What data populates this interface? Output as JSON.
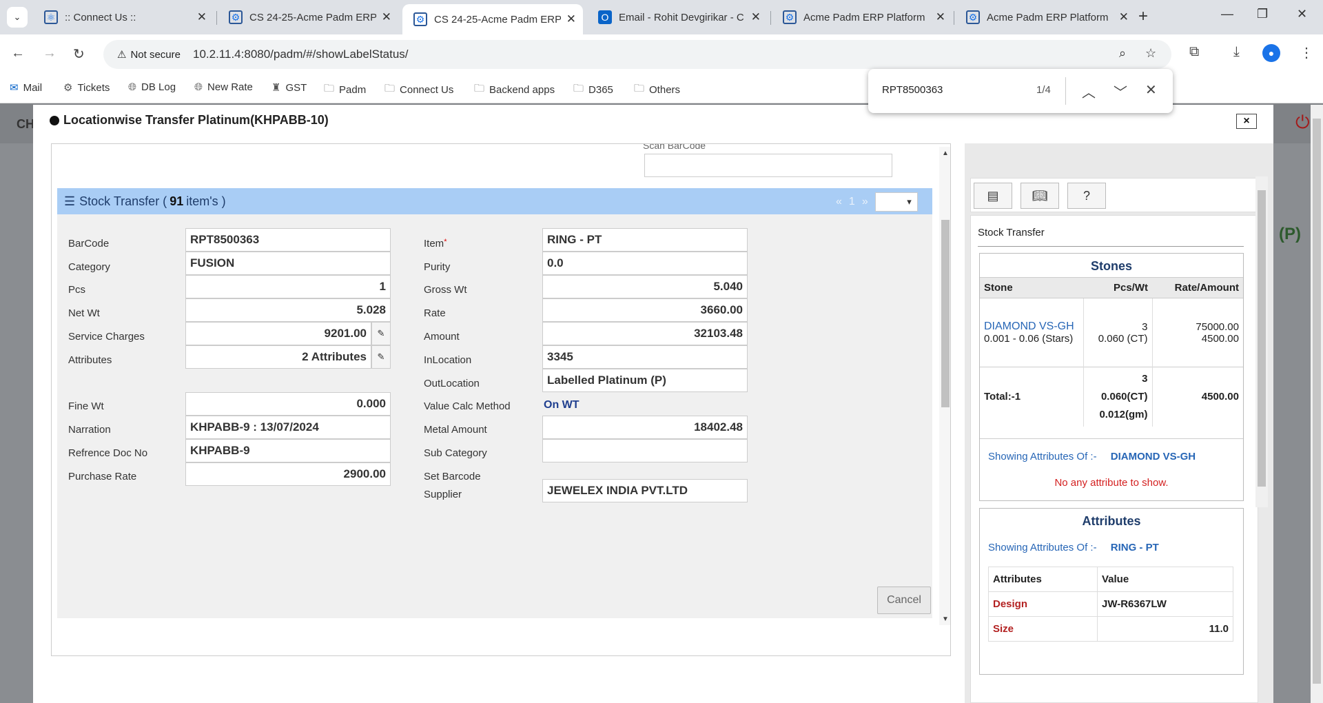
{
  "browser": {
    "tabs": [
      {
        "title": ":: Connect Us ::",
        "active": false
      },
      {
        "title": "CS 24-25-Acme Padm ERP",
        "active": false
      },
      {
        "title": "CS 24-25-Acme Padm ERP",
        "active": true
      },
      {
        "title": "Email - Rohit Devgirikar - C",
        "active": false
      },
      {
        "title": "Acme Padm ERP Platform",
        "active": false
      },
      {
        "title": "Acme Padm ERP Platform",
        "active": false
      }
    ],
    "security_label": "Not secure",
    "url": "10.2.11.4:8080/padm/#/showLabelStatus/",
    "bookmarks": [
      "Mail",
      "Tickets",
      "DB Log",
      "New Rate",
      "GST",
      "Padm",
      "Connect Us",
      "Backend apps",
      "D365",
      "Others"
    ]
  },
  "findbar": {
    "query": "RPT8500363",
    "count": "1/4"
  },
  "background": {
    "left_text": "CH",
    "right_label": "(P)"
  },
  "modal": {
    "title": "Locationwise Transfer Platinum(KHPABB-10)",
    "close": "×",
    "scan_label": "Scan BarCode",
    "stock": {
      "label_pre": "Stock Transfer (",
      "count": "91",
      "label_post": "item's )",
      "pager_prev": "«",
      "pager_page": "1",
      "pager_next": "»"
    },
    "left_fields": {
      "barcode": {
        "label": "BarCode",
        "value": "RPT8500363"
      },
      "category": {
        "label": "Category",
        "value": "FUSION"
      },
      "pcs": {
        "label": "Pcs",
        "value": "1"
      },
      "net_wt": {
        "label": "Net Wt",
        "value": "5.028"
      },
      "service_charges": {
        "label": "Service Charges",
        "value": "9201.00"
      },
      "attributes": {
        "label": "Attributes",
        "value": "2 Attributes"
      },
      "fine_wt": {
        "label": "Fine Wt",
        "value": "0.000"
      },
      "narration": {
        "label": "Narration",
        "value": "KHPABB-9 : 13/07/2024"
      },
      "ref_doc": {
        "label": "Refrence Doc No",
        "value": "KHPABB-9"
      },
      "purchase_rate": {
        "label": "Purchase Rate",
        "value": "2900.00"
      }
    },
    "right_fields": {
      "item": {
        "label": "Item",
        "required": "*",
        "value": "RING - PT"
      },
      "purity": {
        "label": "Purity",
        "value": "0.0"
      },
      "gross_wt": {
        "label": "Gross Wt",
        "value": "5.040"
      },
      "rate": {
        "label": "Rate",
        "value": "3660.00"
      },
      "amount": {
        "label": "Amount",
        "value": "32103.48"
      },
      "in_location": {
        "label": "InLocation",
        "value": "3345"
      },
      "out_location": {
        "label": "OutLocation",
        "value": "Labelled Platinum (P)"
      },
      "value_calc": {
        "label": "Value Calc Method",
        "value": "On WT"
      },
      "metal_amount": {
        "label": "Metal Amount",
        "value": "18402.48"
      },
      "sub_category": {
        "label": "Sub Category",
        "value": ""
      },
      "set_barcode": {
        "label": "Set Barcode"
      },
      "supplier": {
        "label": "Supplier",
        "value": "JEWELEX INDIA PVT.LTD"
      }
    },
    "cancel": "Cancel"
  },
  "side": {
    "title": "Stock Transfer",
    "stones": {
      "heading": "Stones",
      "headers": [
        "Stone",
        "Pcs/Wt",
        "Rate/Amount"
      ],
      "row": {
        "name": "DIAMOND VS-GH",
        "sub": "0.001 - 0.06 (Stars)",
        "pcs": "3",
        "wt": "0.060 (CT)",
        "rate": "75000.00",
        "amount": "4500.00"
      },
      "total": {
        "label": "Total:-1",
        "pcs": "3",
        "ct": "0.060(CT)",
        "gm": "0.012(gm)",
        "amount": "4500.00"
      },
      "showing_label": "Showing Attributes Of :-",
      "showing_value": "DIAMOND VS-GH",
      "no_attr": "No any attribute to show."
    },
    "attributes": {
      "heading": "Attributes",
      "showing_label": "Showing Attributes Of :-",
      "showing_value": "RING - PT",
      "headers": [
        "Attributes",
        "Value"
      ],
      "rows": [
        {
          "name": "Design",
          "value": "JW-R6367LW"
        },
        {
          "name": "Size",
          "value": "11.0"
        }
      ]
    }
  }
}
